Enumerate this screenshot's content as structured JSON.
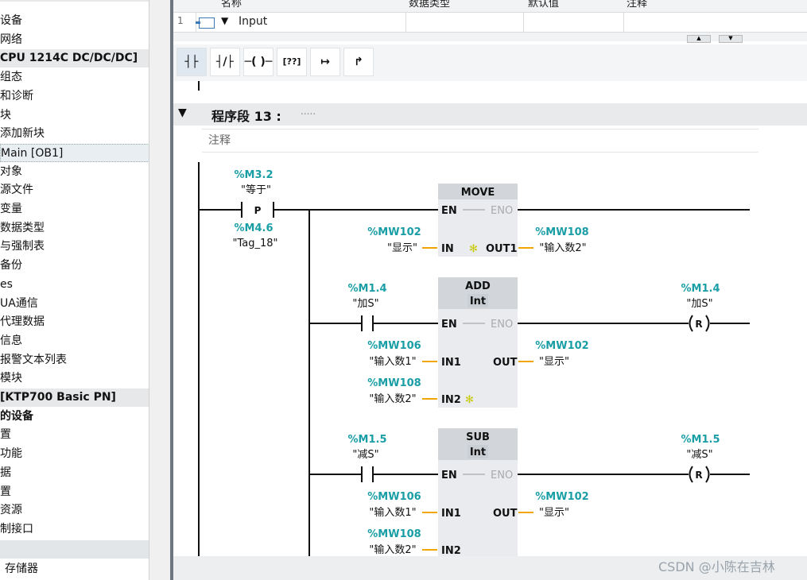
{
  "tree": {
    "items": [
      {
        "label": "设备",
        "style": "plain"
      },
      {
        "label": "网络",
        "style": "plain"
      },
      {
        "label": "CPU 1214C DC/DC/DC]",
        "style": "grp"
      },
      {
        "label": "组态",
        "style": "plain"
      },
      {
        "label": "和诊断",
        "style": "plain"
      },
      {
        "label": "块",
        "style": "plain"
      },
      {
        "label": "添加新块",
        "style": "plain"
      },
      {
        "label": "Main [OB1]",
        "style": "sel"
      },
      {
        "label": "对象",
        "style": "plain"
      },
      {
        "label": "源文件",
        "style": "plain"
      },
      {
        "label": "变量",
        "style": "plain"
      },
      {
        "label": "数据类型",
        "style": "plain"
      },
      {
        "label": "与强制表",
        "style": "plain"
      },
      {
        "label": "备份",
        "style": "plain"
      },
      {
        "label": "es",
        "style": "plain"
      },
      {
        "label": "UA通信",
        "style": "plain"
      },
      {
        "label": "代理数据",
        "style": "plain"
      },
      {
        "label": "信息",
        "style": "plain"
      },
      {
        "label": "报警文本列表",
        "style": "plain"
      },
      {
        "label": "模块",
        "style": "plain"
      },
      {
        "label": "[KTP700 Basic PN]",
        "style": "grp"
      },
      {
        "label": "的设备",
        "style": "grpb"
      },
      {
        "label": "置",
        "style": "plain"
      },
      {
        "label": "功能",
        "style": "plain"
      },
      {
        "label": "据",
        "style": "plain"
      },
      {
        "label": "置",
        "style": "plain"
      },
      {
        "label": "资源",
        "style": "plain"
      },
      {
        "label": "制接口",
        "style": "plain"
      },
      {
        "label": "",
        "style": "gray"
      },
      {
        "label": "存储器",
        "style": "plain"
      }
    ]
  },
  "interface": {
    "headers": [
      "名称",
      "数据类型",
      "默认值",
      "注释"
    ],
    "row_number": "1",
    "row_name": "Input",
    "row_expand": "▼"
  },
  "toolbar": {
    "buttons": [
      {
        "label": "┤├",
        "icon": "no-contact-icon"
      },
      {
        "label": "┤/├",
        "icon": "nc-contact-icon"
      },
      {
        "label": "─( )─",
        "icon": "coil-icon"
      },
      {
        "label": "[??]",
        "icon": "empty-box-icon"
      },
      {
        "label": "↦",
        "icon": "open-branch-icon"
      },
      {
        "label": "↱",
        "icon": "close-branch-icon"
      }
    ]
  },
  "segment": {
    "title": "程序段 13 :",
    "dots": ".....",
    "comment": "注释",
    "expand": "▼"
  },
  "rung1": {
    "contact_addr": "%M3.2",
    "contact_name": "\"等于\"",
    "contact_type": "P",
    "edge_addr": "%M4.6",
    "edge_name": "\"Tag_18\"",
    "block": {
      "title": "MOVE",
      "en": "EN",
      "eno": "ENO",
      "in": "IN",
      "out": "OUT1"
    },
    "in_addr": "%MW102",
    "in_name": "\"显示\"",
    "out_addr": "%MW108",
    "out_name": "\"输入数2\""
  },
  "rung2": {
    "contact_addr": "%M1.4",
    "contact_name": "\"加S\"",
    "block": {
      "title": "ADD",
      "type": "Int",
      "en": "EN",
      "eno": "ENO",
      "in1": "IN1",
      "in2": "IN2",
      "out": "OUT"
    },
    "in1_addr": "%MW106",
    "in1_name": "\"输入数1\"",
    "in2_addr": "%MW108",
    "in2_name": "\"输入数2\"",
    "out_addr": "%MW102",
    "out_name": "\"显示\"",
    "coil_addr": "%M1.4",
    "coil_name": "\"加S\"",
    "coil_type": "R"
  },
  "rung3": {
    "contact_addr": "%M1.5",
    "contact_name": "\"减S\"",
    "block": {
      "title": "SUB",
      "type": "Int",
      "en": "EN",
      "eno": "ENO",
      "in1": "IN1",
      "in2": "IN2",
      "out": "OUT"
    },
    "in1_addr": "%MW106",
    "in1_name": "\"输入数1\"",
    "in2_addr": "%MW108",
    "in2_name": "\"输入数2\"",
    "out_addr": "%MW102",
    "out_name": "\"显示\"",
    "coil_addr": "%M1.5",
    "coil_name": "\"减S\"",
    "coil_type": "R"
  },
  "watermark": "CSDN @小陈在吉林",
  "colors": {
    "operand": "#1a9ea6",
    "wire": "#111111",
    "param_wire": "#f0a500",
    "block_head": "#d2d6db",
    "block_body": "#e9ebee",
    "star": "#c8c800"
  }
}
